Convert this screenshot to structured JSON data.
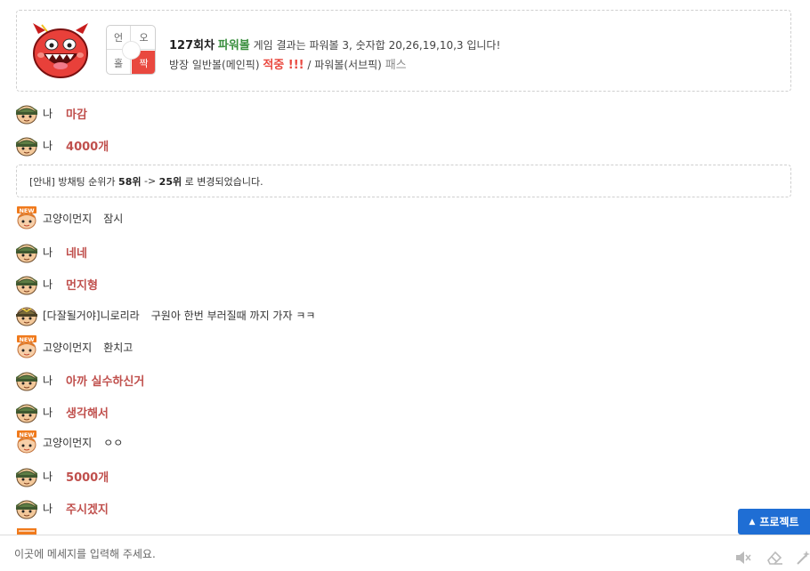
{
  "result": {
    "oe_grid": {
      "top_left": "언",
      "top_right": "오",
      "bottom_left": "홀",
      "bottom_right": "짝"
    },
    "round": "127회차",
    "game": "파워볼",
    "line1_rest": "게임 결과는 파워볼 3, 숫자합 20,26,19,10,3 입니다!",
    "line2_prefix": "방장 일반볼(메인픽)",
    "hit": "적중 !!!",
    "line2_mid": "/ 파워볼(서브픽)",
    "pass": "패스"
  },
  "messages": [
    {
      "nick": "나",
      "text": "마감",
      "mine": true,
      "avatar": "soldier-icon"
    },
    {
      "nick": "나",
      "text": "4000개",
      "mine": true,
      "avatar": "soldier-icon"
    },
    {
      "nick": "고양이먼지",
      "text": "잠시",
      "mine": false,
      "avatar": "new-baby-icon"
    },
    {
      "nick": "나",
      "text": "네네",
      "mine": true,
      "avatar": "soldier-icon"
    },
    {
      "nick": "나",
      "text": "먼지형",
      "mine": true,
      "avatar": "soldier-icon"
    },
    {
      "nick": "[다잘될거야]니로리라",
      "text": "구원아 한번 부러질때 까지 가자 ㅋㅋ",
      "mine": false,
      "avatar": "sergeant-icon"
    },
    {
      "nick": "고양이먼지",
      "text": "환치고",
      "mine": false,
      "avatar": "new-baby-icon"
    },
    {
      "nick": "나",
      "text": "아까 실수하신거",
      "mine": true,
      "avatar": "soldier-icon"
    },
    {
      "nick": "나",
      "text": "생각해서",
      "mine": true,
      "avatar": "soldier-icon"
    },
    {
      "nick": "고양이먼지",
      "text": "ㅇㅇ",
      "mine": false,
      "avatar": "new-baby-icon"
    },
    {
      "nick": "나",
      "text": "5000개",
      "mine": true,
      "avatar": "soldier-icon"
    },
    {
      "nick": "나",
      "text": "주시겠지",
      "mine": true,
      "avatar": "soldier-icon"
    }
  ],
  "notice": {
    "prefix": "[안내] 방채팅 순위가",
    "from": "58위",
    "arrow": "->",
    "to": "25위",
    "suffix": "로 변경되었습니다."
  },
  "input": {
    "placeholder": "이곳에 메세지를 입력해 주세요."
  },
  "project_button": {
    "label": "프로젝트",
    "color": "#1f6ed4"
  },
  "colors": {
    "mine_text": "#c0504d",
    "hit": "#e9483f",
    "powerball": "#3a8f3e"
  }
}
